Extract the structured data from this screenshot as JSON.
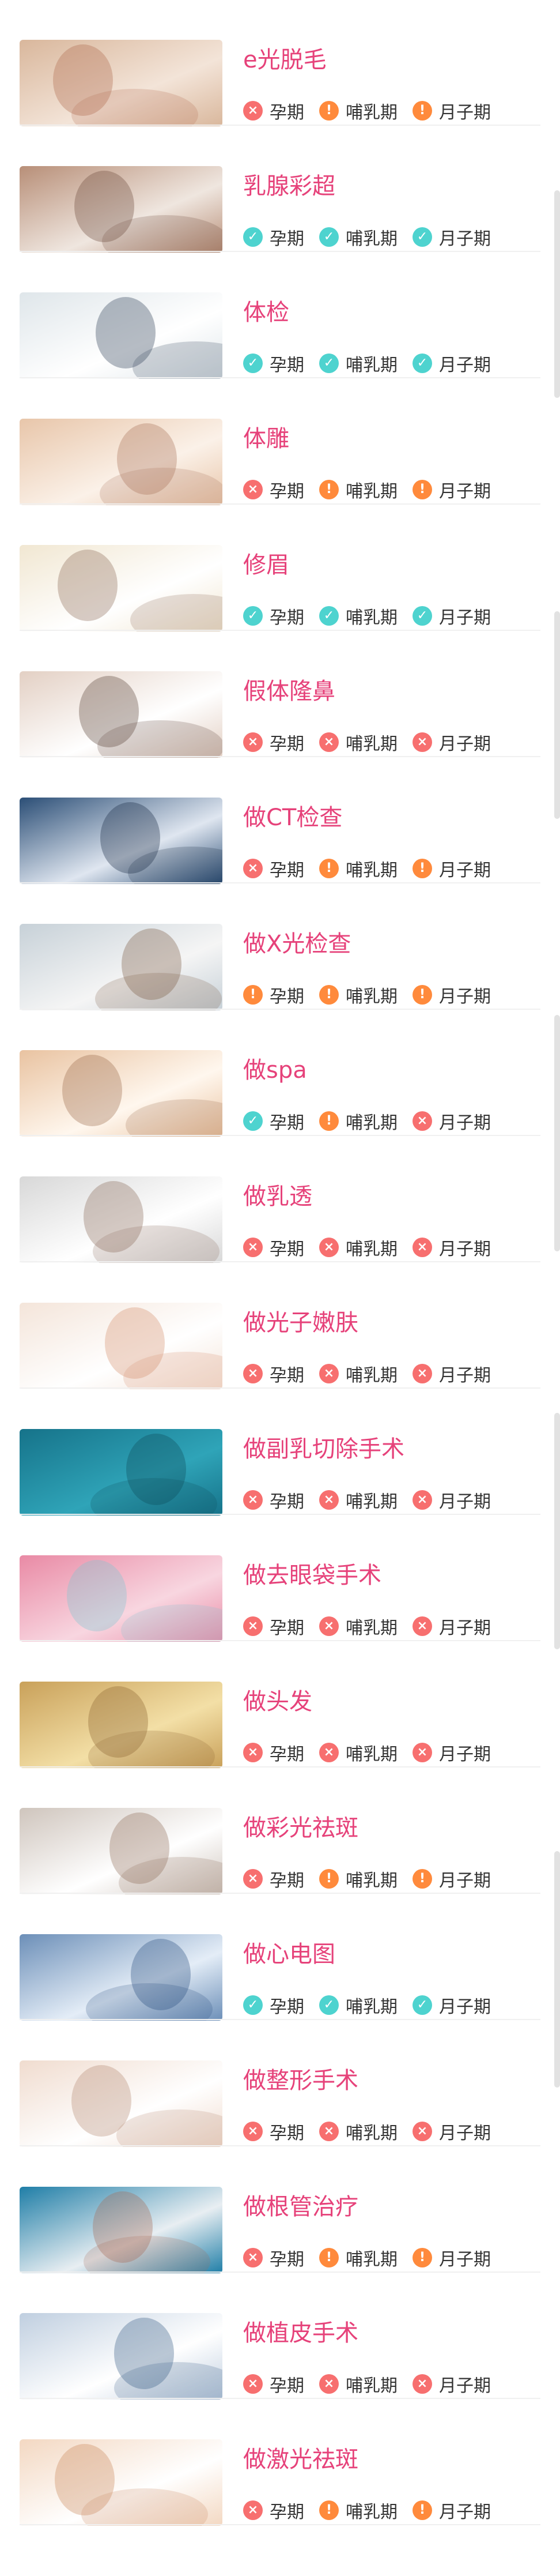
{
  "legend": {
    "pregnancy": "孕期",
    "lactation": "哺乳期",
    "confinement": "月子期"
  },
  "status_glyphs": {
    "no": "×",
    "warn": "!",
    "ok": "✓"
  },
  "status_colors": {
    "no": "#f76f6f",
    "warn": "#ff8a3c",
    "ok": "#4ed3cf",
    "title": "#e6427a"
  },
  "items": [
    {
      "title": "e光脱毛",
      "pregnancy": "no",
      "lactation": "warn",
      "confinement": "warn",
      "image": "woman-laser-treatment-photo"
    },
    {
      "title": "乳腺彩超",
      "pregnancy": "ok",
      "lactation": "ok",
      "confinement": "ok",
      "image": "woman-holding-chest-photo"
    },
    {
      "title": "体检",
      "pregnancy": "ok",
      "lactation": "ok",
      "confinement": "ok",
      "image": "doctor-blood-pressure-photo"
    },
    {
      "title": "体雕",
      "pregnancy": "no",
      "lactation": "warn",
      "confinement": "warn",
      "image": "abdomen-massage-photo"
    },
    {
      "title": "修眉",
      "pregnancy": "ok",
      "lactation": "ok",
      "confinement": "ok",
      "image": "woman-eyebrow-photo"
    },
    {
      "title": "假体隆鼻",
      "pregnancy": "no",
      "lactation": "no",
      "confinement": "no",
      "image": "two-faces-profile-photo"
    },
    {
      "title": "做CT检查",
      "pregnancy": "no",
      "lactation": "warn",
      "confinement": "warn",
      "image": "doctors-xray-photo"
    },
    {
      "title": "做X光检查",
      "pregnancy": "warn",
      "lactation": "warn",
      "confinement": "warn",
      "image": "clinic-consultation-photo"
    },
    {
      "title": "做spa",
      "pregnancy": "ok",
      "lactation": "warn",
      "confinement": "no",
      "image": "face-spa-massage-photo"
    },
    {
      "title": "做乳透",
      "pregnancy": "no",
      "lactation": "no",
      "confinement": "no",
      "image": "woman-lying-pillows-photo"
    },
    {
      "title": "做光子嫩肤",
      "pregnancy": "no",
      "lactation": "no",
      "confinement": "no",
      "image": "facial-mask-photo"
    },
    {
      "title": "做副乳切除手术",
      "pregnancy": "no",
      "lactation": "no",
      "confinement": "no",
      "image": "surgical-instruments-photo"
    },
    {
      "title": "做去眼袋手术",
      "pregnancy": "no",
      "lactation": "no",
      "confinement": "no",
      "image": "eye-pad-photo"
    },
    {
      "title": "做头发",
      "pregnancy": "no",
      "lactation": "no",
      "confinement": "no",
      "image": "curly-hair-woman-photo"
    },
    {
      "title": "做彩光祛斑",
      "pregnancy": "no",
      "lactation": "warn",
      "confinement": "warn",
      "image": "facial-cleansing-photo"
    },
    {
      "title": "做心电图",
      "pregnancy": "ok",
      "lactation": "ok",
      "confinement": "ok",
      "image": "ecg-screen-photo"
    },
    {
      "title": "做整形手术",
      "pregnancy": "no",
      "lactation": "no",
      "confinement": "no",
      "image": "face-surgery-marking-photo"
    },
    {
      "title": "做根管治疗",
      "pregnancy": "no",
      "lactation": "warn",
      "confinement": "warn",
      "image": "dental-treatment-photo"
    },
    {
      "title": "做植皮手术",
      "pregnancy": "no",
      "lactation": "no",
      "confinement": "no",
      "image": "stethoscope-photo"
    },
    {
      "title": "做激光祛斑",
      "pregnancy": "no",
      "lactation": "warn",
      "confinement": "warn",
      "image": "woman-magnifier-photo"
    }
  ]
}
